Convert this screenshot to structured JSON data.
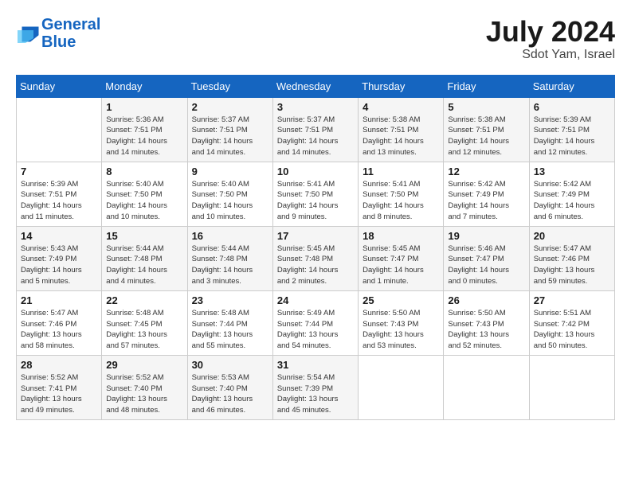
{
  "header": {
    "logo_line1": "General",
    "logo_line2": "Blue",
    "month_year": "July 2024",
    "location": "Sdot Yam, Israel"
  },
  "weekdays": [
    "Sunday",
    "Monday",
    "Tuesday",
    "Wednesday",
    "Thursday",
    "Friday",
    "Saturday"
  ],
  "weeks": [
    [
      {
        "day": "",
        "info": ""
      },
      {
        "day": "1",
        "info": "Sunrise: 5:36 AM\nSunset: 7:51 PM\nDaylight: 14 hours\nand 14 minutes."
      },
      {
        "day": "2",
        "info": "Sunrise: 5:37 AM\nSunset: 7:51 PM\nDaylight: 14 hours\nand 14 minutes."
      },
      {
        "day": "3",
        "info": "Sunrise: 5:37 AM\nSunset: 7:51 PM\nDaylight: 14 hours\nand 14 minutes."
      },
      {
        "day": "4",
        "info": "Sunrise: 5:38 AM\nSunset: 7:51 PM\nDaylight: 14 hours\nand 13 minutes."
      },
      {
        "day": "5",
        "info": "Sunrise: 5:38 AM\nSunset: 7:51 PM\nDaylight: 14 hours\nand 12 minutes."
      },
      {
        "day": "6",
        "info": "Sunrise: 5:39 AM\nSunset: 7:51 PM\nDaylight: 14 hours\nand 12 minutes."
      }
    ],
    [
      {
        "day": "7",
        "info": "Sunrise: 5:39 AM\nSunset: 7:51 PM\nDaylight: 14 hours\nand 11 minutes."
      },
      {
        "day": "8",
        "info": "Sunrise: 5:40 AM\nSunset: 7:50 PM\nDaylight: 14 hours\nand 10 minutes."
      },
      {
        "day": "9",
        "info": "Sunrise: 5:40 AM\nSunset: 7:50 PM\nDaylight: 14 hours\nand 10 minutes."
      },
      {
        "day": "10",
        "info": "Sunrise: 5:41 AM\nSunset: 7:50 PM\nDaylight: 14 hours\nand 9 minutes."
      },
      {
        "day": "11",
        "info": "Sunrise: 5:41 AM\nSunset: 7:50 PM\nDaylight: 14 hours\nand 8 minutes."
      },
      {
        "day": "12",
        "info": "Sunrise: 5:42 AM\nSunset: 7:49 PM\nDaylight: 14 hours\nand 7 minutes."
      },
      {
        "day": "13",
        "info": "Sunrise: 5:42 AM\nSunset: 7:49 PM\nDaylight: 14 hours\nand 6 minutes."
      }
    ],
    [
      {
        "day": "14",
        "info": "Sunrise: 5:43 AM\nSunset: 7:49 PM\nDaylight: 14 hours\nand 5 minutes."
      },
      {
        "day": "15",
        "info": "Sunrise: 5:44 AM\nSunset: 7:48 PM\nDaylight: 14 hours\nand 4 minutes."
      },
      {
        "day": "16",
        "info": "Sunrise: 5:44 AM\nSunset: 7:48 PM\nDaylight: 14 hours\nand 3 minutes."
      },
      {
        "day": "17",
        "info": "Sunrise: 5:45 AM\nSunset: 7:48 PM\nDaylight: 14 hours\nand 2 minutes."
      },
      {
        "day": "18",
        "info": "Sunrise: 5:45 AM\nSunset: 7:47 PM\nDaylight: 14 hours\nand 1 minute."
      },
      {
        "day": "19",
        "info": "Sunrise: 5:46 AM\nSunset: 7:47 PM\nDaylight: 14 hours\nand 0 minutes."
      },
      {
        "day": "20",
        "info": "Sunrise: 5:47 AM\nSunset: 7:46 PM\nDaylight: 13 hours\nand 59 minutes."
      }
    ],
    [
      {
        "day": "21",
        "info": "Sunrise: 5:47 AM\nSunset: 7:46 PM\nDaylight: 13 hours\nand 58 minutes."
      },
      {
        "day": "22",
        "info": "Sunrise: 5:48 AM\nSunset: 7:45 PM\nDaylight: 13 hours\nand 57 minutes."
      },
      {
        "day": "23",
        "info": "Sunrise: 5:48 AM\nSunset: 7:44 PM\nDaylight: 13 hours\nand 55 minutes."
      },
      {
        "day": "24",
        "info": "Sunrise: 5:49 AM\nSunset: 7:44 PM\nDaylight: 13 hours\nand 54 minutes."
      },
      {
        "day": "25",
        "info": "Sunrise: 5:50 AM\nSunset: 7:43 PM\nDaylight: 13 hours\nand 53 minutes."
      },
      {
        "day": "26",
        "info": "Sunrise: 5:50 AM\nSunset: 7:43 PM\nDaylight: 13 hours\nand 52 minutes."
      },
      {
        "day": "27",
        "info": "Sunrise: 5:51 AM\nSunset: 7:42 PM\nDaylight: 13 hours\nand 50 minutes."
      }
    ],
    [
      {
        "day": "28",
        "info": "Sunrise: 5:52 AM\nSunset: 7:41 PM\nDaylight: 13 hours\nand 49 minutes."
      },
      {
        "day": "29",
        "info": "Sunrise: 5:52 AM\nSunset: 7:40 PM\nDaylight: 13 hours\nand 48 minutes."
      },
      {
        "day": "30",
        "info": "Sunrise: 5:53 AM\nSunset: 7:40 PM\nDaylight: 13 hours\nand 46 minutes."
      },
      {
        "day": "31",
        "info": "Sunrise: 5:54 AM\nSunset: 7:39 PM\nDaylight: 13 hours\nand 45 minutes."
      },
      {
        "day": "",
        "info": ""
      },
      {
        "day": "",
        "info": ""
      },
      {
        "day": "",
        "info": ""
      }
    ]
  ]
}
